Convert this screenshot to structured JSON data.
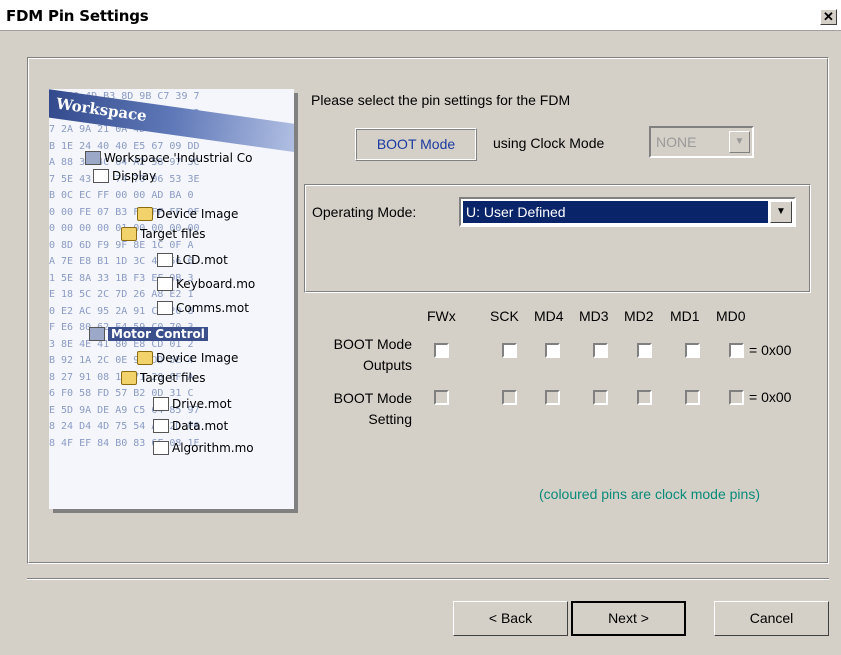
{
  "window": {
    "title": "FDM Pin Settings",
    "close_label": "✕"
  },
  "image": {
    "hex_lines": [
      "8F C0 4D B3 8D 9B C7 39 7",
      "5F 35 B2 D1 40 DA FF 5B 3",
      "7 2A 9A 21 0A 4D 5D 19 2F",
      "B 1E 24 40 40 E5 67 09 DD",
      "A 88 3F 4C 64 A2 58 97 3C",
      "7 5E 43 2D 74 70 06 53 3E",
      "B 0C EC FF 00 00 AD BA 0",
      "0 00 FE 07 B3 FF FF FF 0F",
      "0 00 00 00 01 00 00 00 00",
      "0 8D 6D F9 9F 8E 1C 0F A",
      "A 7E E8 B1 1D 3C 42 56 6",
      "1 5E 8A 33 1B F3 EF 9B 3",
      "E 18 5C 2C 7D 26 A8 E2 1",
      "0 E2 AC 95 2A 91 C7 20 8",
      "F E6 80 62 E4 59 C0 70 3",
      "3 8E 4E 41 80 E8 CD 01 2",
      "B 92 1A 2C 0E 98 DD 5E 4",
      "8 27 91 08 14 71 28 6F A",
      "6 F0 58 FD 57 B2 0D 31 C",
      "E 5D 9A DE A9 C5 64 85 97",
      "8 24 D4 4D 75 54 AD 2D F6",
      "8 4F EF 84 B0 83 6F 08 1E"
    ],
    "workspace_label": "Workspace",
    "tree": [
      {
        "label": "Workspace 'Industrial Co",
        "icon": "ws"
      },
      {
        "label": "Display",
        "icon": "doc"
      },
      {
        "label": "Device Image",
        "icon": "folder"
      },
      {
        "label": "Target files",
        "icon": "folder"
      },
      {
        "label": "LCD.mot",
        "icon": "doc"
      },
      {
        "label": "Keyboard.mo",
        "icon": "doc"
      },
      {
        "label": "Comms.mot",
        "icon": "doc"
      },
      {
        "label": "Motor Control",
        "icon": "ws"
      },
      {
        "label": "Device Image",
        "icon": "folder"
      },
      {
        "label": "Target files",
        "icon": "folder"
      },
      {
        "label": "Drive.mot",
        "icon": "doc"
      },
      {
        "label": "Data.mot",
        "icon": "doc"
      },
      {
        "label": "Algorithm.mo",
        "icon": "doc"
      }
    ]
  },
  "prompt": "Please select the pin settings for the FDM",
  "boot_mode_label": "BOOT Mode",
  "using_clock_label": "using Clock Mode",
  "clock_mode": {
    "value": "NONE",
    "disabled": true
  },
  "operating_mode": {
    "label": "Operating Mode:",
    "value": "U: User Defined"
  },
  "pins": {
    "columns": [
      "FWx",
      "SCK",
      "MD4",
      "MD3",
      "MD2",
      "MD1",
      "MD0"
    ],
    "rows": [
      {
        "label_line1": "BOOT Mode",
        "label_line2": "Outputs",
        "checked": [
          false,
          false,
          false,
          false,
          false,
          false,
          false
        ],
        "enabled": true,
        "hex": "= 0x00"
      },
      {
        "label_line1": "BOOT Mode",
        "label_line2": "Setting",
        "checked": [
          false,
          false,
          false,
          false,
          false,
          false,
          false
        ],
        "enabled": false,
        "hex": "= 0x00"
      }
    ],
    "note": "(coloured pins are clock mode pins)"
  },
  "buttons": {
    "back": "< Back",
    "next": "Next >",
    "cancel": "Cancel"
  },
  "colors": {
    "selection": "#0a246a",
    "boot_text": "#1c3aa0",
    "note_text": "#0a8a7a",
    "dialog_bg": "#d4d0c8"
  }
}
